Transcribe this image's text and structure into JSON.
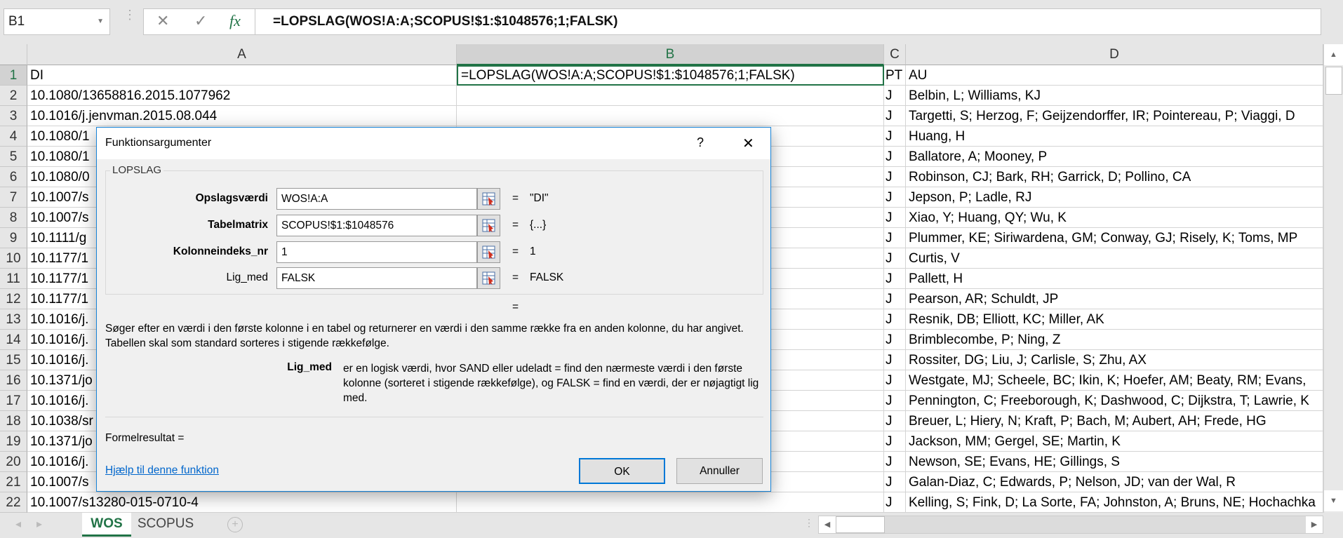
{
  "formula_bar": {
    "name_box": "B1",
    "cancel_icon": "✕",
    "enter_icon": "✓",
    "fx_label": "fx",
    "formula": "=LOPSLAG(WOS!A:A;SCOPUS!$1:$1048576;1;FALSK)"
  },
  "columns": [
    "A",
    "B",
    "C",
    "D"
  ],
  "selected_column": "B",
  "rows": [
    {
      "n": "1",
      "a": "DI",
      "b": "=LOPSLAG(WOS!A:A;SCOPUS!$1:$1048576;1;FALSK)",
      "c": "PT",
      "d": "AU"
    },
    {
      "n": "2",
      "a": "10.1080/13658816.2015.1077962",
      "b": "",
      "c": "J",
      "d": "Belbin, L; Williams, KJ"
    },
    {
      "n": "3",
      "a": "10.1016/j.jenvman.2015.08.044",
      "b": "",
      "c": "J",
      "d": "Targetti, S; Herzog, F; Geijzendorffer, IR; Pointereau, P; Viaggi, D"
    },
    {
      "n": "4",
      "a": "10.1080/1",
      "b": "",
      "c": "J",
      "d": "Huang, H"
    },
    {
      "n": "5",
      "a": "10.1080/1",
      "b": "",
      "c": "J",
      "d": "Ballatore, A; Mooney, P"
    },
    {
      "n": "6",
      "a": "10.1080/0",
      "b": "",
      "c": "J",
      "d": "Robinson, CJ; Bark, RH; Garrick, D; Pollino, CA"
    },
    {
      "n": "7",
      "a": "10.1007/s",
      "b": "",
      "c": "J",
      "d": "Jepson, P; Ladle, RJ"
    },
    {
      "n": "8",
      "a": "10.1007/s",
      "b": "",
      "c": "J",
      "d": "Xiao, Y; Huang, QY; Wu, K"
    },
    {
      "n": "9",
      "a": "10.1111/g",
      "b": "",
      "c": "J",
      "d": "Plummer, KE; Siriwardena, GM; Conway, GJ; Risely, K; Toms, MP"
    },
    {
      "n": "10",
      "a": "10.1177/1",
      "b": "",
      "c": "J",
      "d": "Curtis, V"
    },
    {
      "n": "11",
      "a": "10.1177/1",
      "b": "",
      "c": "J",
      "d": "Pallett, H"
    },
    {
      "n": "12",
      "a": "10.1177/1",
      "b": "",
      "c": "J",
      "d": "Pearson, AR; Schuldt, JP"
    },
    {
      "n": "13",
      "a": "10.1016/j.",
      "b": "",
      "c": "J",
      "d": "Resnik, DB; Elliott, KC; Miller, AK"
    },
    {
      "n": "14",
      "a": "10.1016/j.",
      "b": "",
      "c": "J",
      "d": "Brimblecombe, P; Ning, Z"
    },
    {
      "n": "15",
      "a": "10.1016/j.",
      "b": "",
      "c": "J",
      "d": "Rossiter, DG; Liu, J; Carlisle, S; Zhu, AX"
    },
    {
      "n": "16",
      "a": "10.1371/jo",
      "b": "",
      "c": "J",
      "d": "Westgate, MJ; Scheele, BC; Ikin, K; Hoefer, AM; Beaty, RM; Evans,"
    },
    {
      "n": "17",
      "a": "10.1016/j.",
      "b": "",
      "c": "J",
      "d": "Pennington, C; Freeborough, K; Dashwood, C; Dijkstra, T; Lawrie, K"
    },
    {
      "n": "18",
      "a": "10.1038/sr",
      "b": "",
      "c": "J",
      "d": "Breuer, L; Hiery, N; Kraft, P; Bach, M; Aubert, AH; Frede, HG"
    },
    {
      "n": "19",
      "a": "10.1371/jo",
      "b": "",
      "c": "J",
      "d": "Jackson, MM; Gergel, SE; Martin, K"
    },
    {
      "n": "20",
      "a": "10.1016/j.",
      "b": "",
      "c": "J",
      "d": "Newson, SE; Evans, HE; Gillings, S"
    },
    {
      "n": "21",
      "a": "10.1007/s",
      "b": "",
      "c": "J",
      "d": "Galan-Diaz, C; Edwards, P; Nelson, JD; van der Wal, R"
    },
    {
      "n": "22",
      "a": "10.1007/s13280-015-0710-4",
      "b": "",
      "c": "J",
      "d": "Kelling, S; Fink, D; La Sorte, FA; Johnston, A; Bruns, NE; Hochachka"
    }
  ],
  "sheet_tabs": [
    {
      "label": "WOS",
      "active": true
    },
    {
      "label": "SCOPUS",
      "active": false
    }
  ],
  "dialog": {
    "title": "Funktionsargumenter",
    "help_icon": "?",
    "close_icon": "✕",
    "function_name": "LOPSLAG",
    "args": [
      {
        "label": "Opslagsværdi",
        "value": "WOS!A:A",
        "result": "\"DI\"",
        "bold": true
      },
      {
        "label": "Tabelmatrix",
        "value": "SCOPUS!$1:$1048576",
        "result": "{...}",
        "bold": true
      },
      {
        "label": "Kolonneindeks_nr",
        "value": "1",
        "result": "1",
        "bold": true
      },
      {
        "label": "Lig_med",
        "value": "FALSK",
        "result": "FALSK",
        "bold": false
      }
    ],
    "equals": "=",
    "description": "Søger efter en værdi i den første kolonne i en tabel og returnerer en værdi i den samme række fra en anden kolonne, du har angivet. Tabellen skal som standard sorteres i stigende rækkefølge.",
    "arg_help_label": "Lig_med",
    "arg_help_text": "er en logisk værdi, hvor SAND eller udeladt = find den nærmeste værdi i den første kolonne (sorteret i stigende rækkefølge), og FALSK = find en værdi, der er nøjagtigt lig med.",
    "formula_result": "Formelresultat =",
    "help_link": "Hjælp til denne funktion",
    "ok": "OK",
    "cancel": "Annuller"
  },
  "colors": {
    "accent": "#217346",
    "dialog_border": "#1883d7",
    "link": "#0066cc"
  }
}
